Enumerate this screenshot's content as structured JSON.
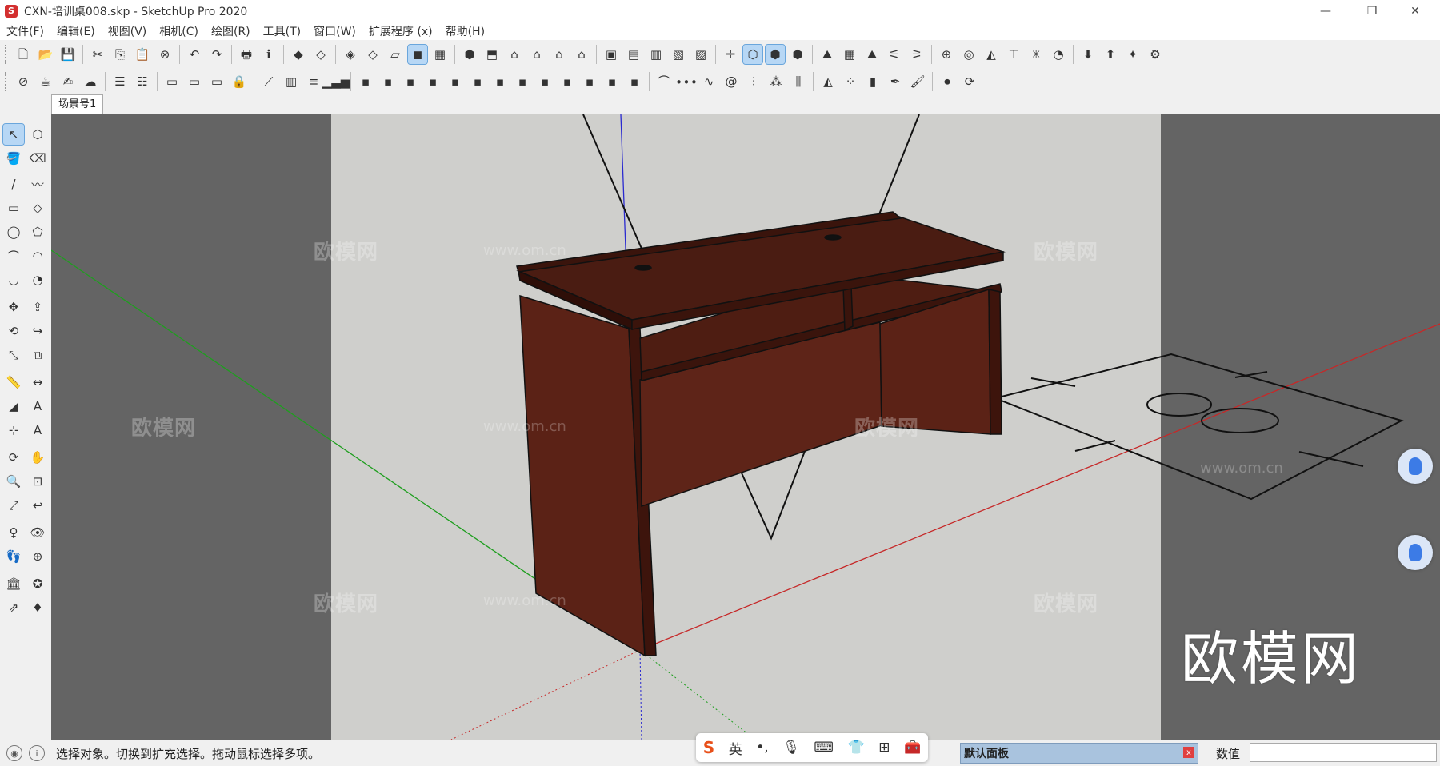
{
  "window": {
    "title": "CXN-培训桌008.skp - SketchUp Pro 2020",
    "app_icon": "sketchup-logo",
    "controls": [
      "minimize-icon",
      "restore-icon",
      "close-icon"
    ]
  },
  "menubar": {
    "items": [
      "文件(F)",
      "编辑(E)",
      "视图(V)",
      "相机(C)",
      "绘图(R)",
      "工具(T)",
      "窗口(W)",
      "扩展程序 (x)",
      "帮助(H)"
    ]
  },
  "toolbar_row1": [
    "new-icon",
    "open-icon",
    "save-icon",
    "|",
    "cut-icon",
    "copy-icon",
    "paste-icon",
    "erase-icon",
    "|",
    "undo-icon",
    "redo-icon",
    "|",
    "print-icon",
    "model-info-icon",
    "|",
    "iso-box-icon",
    "iso-box-outline-icon",
    "|",
    "xray-icon",
    "back-edges-icon",
    "hidden-line-icon",
    "shaded-icon",
    "shaded-texture-icon",
    "|",
    "iso-view-icon",
    "top-view-icon",
    "front-view-icon",
    "right-view-icon",
    "back-view-icon",
    "left-view-icon",
    "|",
    "section-plane-icon",
    "section-fill-icon",
    "section-cut-icon",
    "display-sections-icon",
    "section-fill-toggle-icon",
    "|",
    "axes-move-icon",
    "component-icon",
    "component-edit-icon",
    "component-active-icon",
    "|",
    "sandbox-from-contours-icon",
    "sandbox-from-scratch-icon",
    "smoove-icon",
    "stamp-icon",
    "drape-icon",
    "|",
    "solid-union-icon",
    "solid-subtract-icon",
    "solid-trim-icon",
    "solid-intersect-icon",
    "solid-split-icon",
    "solid-outer-icon",
    "|",
    "extension-warehouse-icon",
    "3d-warehouse-icon",
    "share-component-icon",
    "extension-manager-icon"
  ],
  "toolbar_row2": [
    "style-icon",
    "teapot-icon",
    "sketch-icon",
    "cloud-icon",
    "|",
    "layer-add-icon",
    "layer-remove-icon",
    "|",
    "camera-frame-icon",
    "camera-frame-2-icon",
    "camera-frame-3-icon",
    "lock-icon",
    "|",
    "stairs-icon",
    "columns-icon",
    "rail-icon",
    "stairs-bars-icon",
    "|",
    "curve-tool-1-icon",
    "curve-tool-2-icon",
    "curve-tool-3-icon",
    "curve-tool-4-icon",
    "curve-tool-5-icon",
    "curve-tool-6-icon",
    "curve-tool-7-icon",
    "curve-tool-8-icon",
    "curve-tool-9-icon",
    "curve-tool-10-icon",
    "curve-tool-11-icon",
    "curve-tool-12-icon",
    "curve-tool-13-icon",
    "|",
    "arch-icon",
    "dots-icon",
    "wave-icon",
    "spiral-icon",
    "fence-icon",
    "grid-icon",
    "pillar-icon",
    "|",
    "mirror-icon",
    "array-icon",
    "box-icon",
    "pen-icon",
    "brush-icon",
    "|",
    "record-icon",
    "sync-icon"
  ],
  "scene_tab": "场景号1",
  "left_tools": [
    [
      "select-icon",
      "component-tool-icon"
    ],
    [
      "paint-bucket-icon",
      "eraser-icon"
    ],
    [
      "line-icon",
      "freehand-icon"
    ],
    [
      "rectangle-icon",
      "rotated-rectangle-icon"
    ],
    [
      "circle-icon",
      "polygon-icon"
    ],
    [
      "arc-icon",
      "two-point-arc-icon"
    ],
    [
      "three-point-arc-icon",
      "pie-icon"
    ],
    [
      "move-icon",
      "push-pull-icon"
    ],
    [
      "rotate-icon",
      "follow-me-icon"
    ],
    [
      "scale-icon",
      "offset-icon"
    ],
    [
      "tape-measure-icon",
      "dimension-icon"
    ],
    [
      "protractor-icon",
      "text-icon"
    ],
    [
      "axes-icon",
      "3d-text-icon"
    ],
    [
      "orbit-icon",
      "pan-icon"
    ],
    [
      "zoom-icon",
      "zoom-window-icon"
    ],
    [
      "zoom-extents-icon",
      "previous-view-icon"
    ],
    [
      "position-camera-icon",
      "look-around-icon"
    ],
    [
      "walk-icon",
      "section-plane-tool-icon"
    ],
    [
      "warehouse-icon",
      "extension-warehouse-tool-icon"
    ],
    [
      "share-model-icon",
      "ruby-icon"
    ]
  ],
  "viewport": {
    "watermark_text": "欧模网",
    "watermark_url": "www.om.cn",
    "big_watermark": "欧模网",
    "colors": {
      "outer_bg": "#646464",
      "inner_bg": "#cfcfcc",
      "wood_dark": "#4a1c12",
      "wood_mid": "#6b2818",
      "axis_red": "#c62828",
      "axis_green": "#1e9e1e",
      "axis_blue": "#2a2ad0"
    }
  },
  "float_buttons": [
    "mouse-icon",
    "mouse-icon"
  ],
  "statusbar": {
    "icons": [
      "geo-location-icon",
      "info-icon"
    ],
    "text": "选择对象。切换到扩充选择。拖动鼠标选择多项。",
    "panel_label": "默认面板",
    "measure_label": "数值",
    "measure_value": ""
  },
  "ime_toolbar": {
    "logo": "S",
    "lang": "英",
    "items": [
      "punctuation-icon",
      "microphone-icon",
      "keyboard-icon",
      "skin-icon",
      "apps-grid-icon",
      "tools-icon"
    ]
  }
}
